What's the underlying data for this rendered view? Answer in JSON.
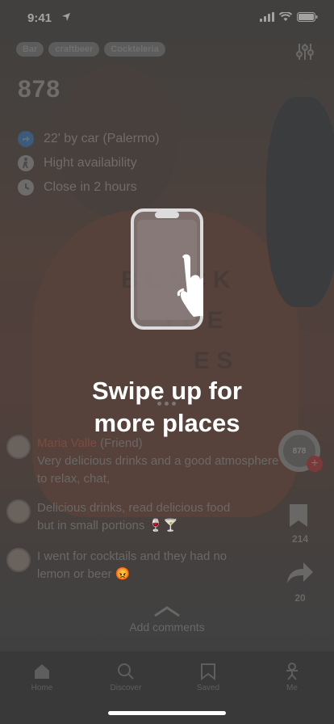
{
  "status": {
    "time": "9:41"
  },
  "tags": [
    "Bar",
    "craftbeer",
    "Cockteleria"
  ],
  "place": {
    "logo": "878",
    "distance": "22' by car (Palermo)",
    "availability": "Hight availability",
    "closing": "Close in 2 hours"
  },
  "tutorial": {
    "line1": "Swipe up for",
    "line2": "more places"
  },
  "comments": [
    {
      "name": "Maria Valle",
      "role": " (Friend)",
      "text": "Very delicious drinks and a good atmosphere to relax, chat,"
    },
    {
      "text": "Delicious drinks, read delicious food but in small portions 🍷🍸"
    },
    {
      "text": "I went for cocktails and they had no lemon or beer 😡"
    }
  ],
  "rail": {
    "badge": "878",
    "saves": "214",
    "shares": "20"
  },
  "add_comments": "Add comments",
  "tabs": [
    {
      "label": "Home",
      "icon": "home-icon"
    },
    {
      "label": "Discover",
      "icon": "search-icon"
    },
    {
      "label": "Saved",
      "icon": "bookmark-icon"
    },
    {
      "label": "Me",
      "icon": "person-icon"
    }
  ],
  "colors": {
    "accent": "#e8432e",
    "overlay": "#464646"
  }
}
